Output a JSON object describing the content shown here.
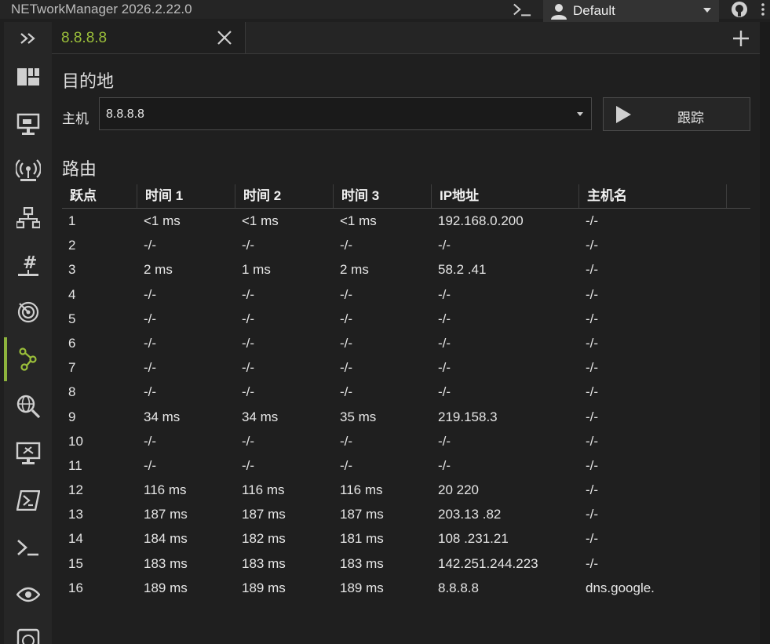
{
  "app": {
    "title": "NETworkManager 2026.2.22.0"
  },
  "profile": {
    "name": "Default"
  },
  "tabs": [
    {
      "label": "8.8.8.8"
    }
  ],
  "destination": {
    "heading": "目的地",
    "host_label": "主机",
    "host_value": "8.8.8.8",
    "trace_button": "跟踪"
  },
  "route": {
    "heading": "路由",
    "columns": [
      "跃点",
      "时间 1",
      "时间 2",
      "时间 3",
      "IP地址",
      "主机名"
    ],
    "rows": [
      [
        "1",
        "<1 ms",
        "<1 ms",
        "<1 ms",
        "192.168.0.200",
        "-/-"
      ],
      [
        "2",
        "-/-",
        "-/-",
        "-/-",
        "-/-",
        "-/-"
      ],
      [
        "3",
        "2 ms",
        "1 ms",
        "2 ms",
        "58.2 .41",
        "-/-"
      ],
      [
        "4",
        "-/-",
        "-/-",
        "-/-",
        "-/-",
        "-/-"
      ],
      [
        "5",
        "-/-",
        "-/-",
        "-/-",
        "-/-",
        "-/-"
      ],
      [
        "6",
        "-/-",
        "-/-",
        "-/-",
        "-/-",
        "-/-"
      ],
      [
        "7",
        "-/-",
        "-/-",
        "-/-",
        "-/-",
        "-/-"
      ],
      [
        "8",
        "-/-",
        "-/-",
        "-/-",
        "-/-",
        "-/-"
      ],
      [
        "9",
        "34 ms",
        "34 ms",
        "35 ms",
        "219.158.3",
        "-/-"
      ],
      [
        "10",
        "-/-",
        "-/-",
        "-/-",
        "-/-",
        "-/-"
      ],
      [
        "11",
        "-/-",
        "-/-",
        "-/-",
        "-/-",
        "-/-"
      ],
      [
        "12",
        "116 ms",
        "116 ms",
        "116 ms",
        "20 220",
        "-/-"
      ],
      [
        "13",
        "187 ms",
        "187 ms",
        "187 ms",
        "203.13 .82",
        "-/-"
      ],
      [
        "14",
        "184 ms",
        "182 ms",
        "181 ms",
        "108 .231.21",
        "-/-"
      ],
      [
        "15",
        "183 ms",
        "183 ms",
        "183 ms",
        "142.251.244.223",
        "-/-"
      ],
      [
        "16",
        "189 ms",
        "189 ms",
        "189 ms",
        "8.8.8.8",
        "dns.google."
      ]
    ]
  },
  "sidebar": {
    "items": [
      {
        "name": "dashboard-icon"
      },
      {
        "name": "network-interface-icon"
      },
      {
        "name": "wifi-icon"
      },
      {
        "name": "ip-scanner-icon"
      },
      {
        "name": "subnet-calculator-icon"
      },
      {
        "name": "port-scanner-icon"
      },
      {
        "name": "traceroute-icon",
        "active": true
      },
      {
        "name": "dns-lookup-icon"
      },
      {
        "name": "remote-desktop-icon"
      },
      {
        "name": "powershell-icon"
      },
      {
        "name": "putty-icon"
      },
      {
        "name": "eye-icon"
      },
      {
        "name": "speed-icon"
      }
    ]
  },
  "colors": {
    "accent": "#8db33d",
    "tab_label": "#9bbf3a",
    "background": "#1f1f1f"
  }
}
